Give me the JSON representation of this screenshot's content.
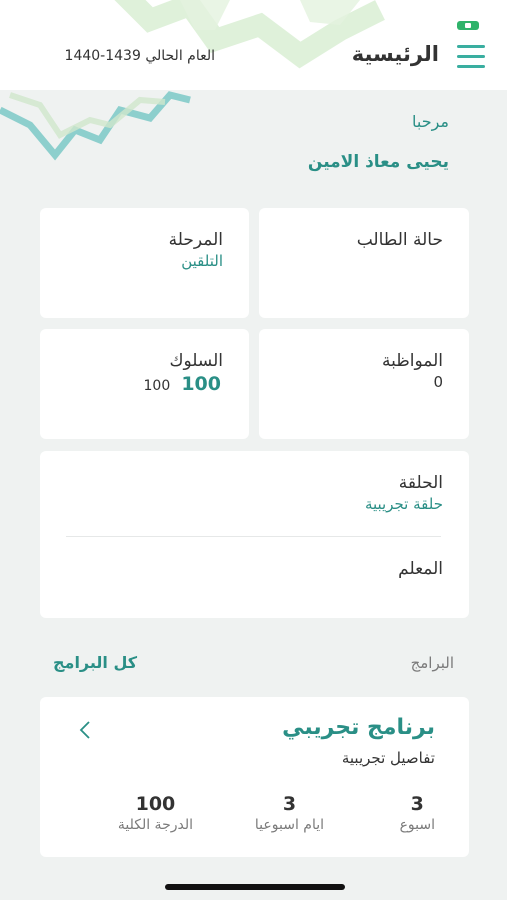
{
  "header": {
    "title": "الرئيسية",
    "year_prefix": "العام الحالي",
    "year_value": "1440-1439"
  },
  "welcome": {
    "greeting": "مرحبا",
    "name": "يحيى  معاذ الامين"
  },
  "cards": {
    "student_status": {
      "title": "حالة الطالب",
      "value": ""
    },
    "stage": {
      "title": "المرحلة",
      "value": "التلقين"
    },
    "attendance": {
      "title": "المواظبة",
      "value": "0"
    },
    "behavior": {
      "title": "السلوك",
      "value_big": "100",
      "value_small": "100"
    },
    "halaqa": {
      "title": "الحلقة",
      "value": "حلقة تجريبية"
    },
    "teacher": {
      "title": "المعلم",
      "value": ""
    }
  },
  "programs": {
    "section_label": "البرامج",
    "all_link": "كل البرامج",
    "items": [
      {
        "title": "برنامج تجريبي",
        "subtitle": "تفاصيل تجريبية",
        "stats": [
          {
            "value": "3",
            "label": "اسبوع"
          },
          {
            "value": "3",
            "label": "ايام اسبوعيا"
          },
          {
            "value": "100",
            "label": "الدرجة الكلية"
          }
        ]
      }
    ]
  },
  "colors": {
    "accent": "#2a8f86",
    "background": "#eff2f1",
    "card": "#ffffff"
  },
  "icons": {
    "menu": "hamburger-menu-icon",
    "chevron": "chevron-left-icon"
  }
}
